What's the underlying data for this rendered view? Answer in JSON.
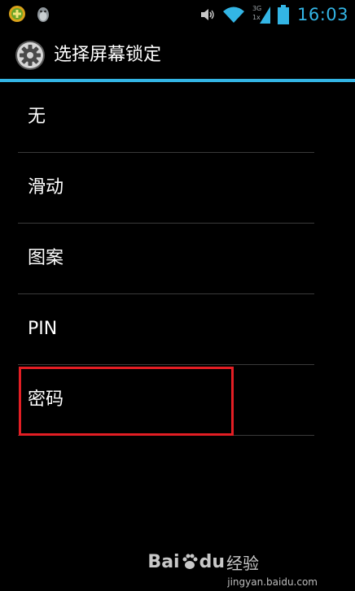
{
  "status_bar": {
    "time": "16:03",
    "network_type_top": "3G",
    "network_type_bottom": "1x",
    "icons": [
      "app-notification-icon",
      "qq-penguin-icon",
      "volume-icon",
      "wifi-icon",
      "signal-icon",
      "battery-icon"
    ]
  },
  "header": {
    "title": "选择屏幕锁定",
    "icon": "settings-gear-icon"
  },
  "options": [
    {
      "label": "无"
    },
    {
      "label": "滑动"
    },
    {
      "label": "图案"
    },
    {
      "label": "PIN"
    },
    {
      "label": "密码"
    }
  ],
  "highlighted_option": "密码",
  "watermark": {
    "brand_bai": "Bai",
    "brand_du": "du",
    "brand_jingyan": "经验",
    "url": "jingyan.baidu.com"
  },
  "colors": {
    "accent": "#33b5e5",
    "highlight_box": "#e31e24",
    "background": "#000000"
  }
}
